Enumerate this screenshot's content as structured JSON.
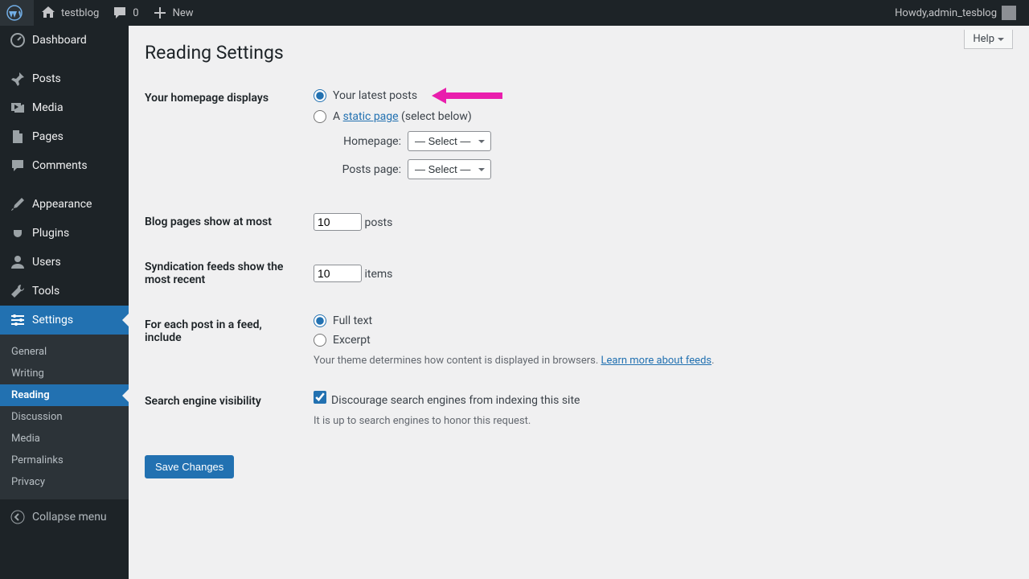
{
  "adminbar": {
    "site_name": "testblog",
    "comments_count": "0",
    "new_label": "New",
    "howdy_prefix": "Howdy, ",
    "user_name": "admin_tesblog"
  },
  "sidebar": {
    "items": [
      {
        "label": "Dashboard",
        "icon": "dashboard"
      },
      {
        "label": "Posts",
        "icon": "pin"
      },
      {
        "label": "Media",
        "icon": "media"
      },
      {
        "label": "Pages",
        "icon": "page"
      },
      {
        "label": "Comments",
        "icon": "comment"
      },
      {
        "label": "Appearance",
        "icon": "brush"
      },
      {
        "label": "Plugins",
        "icon": "plug"
      },
      {
        "label": "Users",
        "icon": "user"
      },
      {
        "label": "Tools",
        "icon": "wrench"
      },
      {
        "label": "Settings",
        "icon": "settings"
      }
    ],
    "submenu": [
      {
        "label": "General"
      },
      {
        "label": "Writing"
      },
      {
        "label": "Reading"
      },
      {
        "label": "Discussion"
      },
      {
        "label": "Media"
      },
      {
        "label": "Permalinks"
      },
      {
        "label": "Privacy"
      }
    ],
    "collapse_label": "Collapse menu"
  },
  "page": {
    "help_label": "Help",
    "title": "Reading Settings",
    "homepage_displays_label": "Your homepage displays",
    "latest_posts_label": "Your latest posts",
    "static_page_prefix": "A ",
    "static_page_link": "static page",
    "static_page_suffix": " (select below)",
    "homepage_select_label": "Homepage:",
    "posts_page_select_label": "Posts page:",
    "select_placeholder": "— Select —",
    "blog_pages_label": "Blog pages show at most",
    "blog_pages_value": "10",
    "blog_pages_suffix": "posts",
    "syndication_label": "Syndication feeds show the most recent",
    "syndication_value": "10",
    "syndication_suffix": "items",
    "feed_include_label": "For each post in a feed, include",
    "feed_fulltext_label": "Full text",
    "feed_excerpt_label": "Excerpt",
    "feed_desc_prefix": "Your theme determines how content is displayed in browsers. ",
    "feed_desc_link": "Learn more about feeds",
    "feed_desc_suffix": ".",
    "visibility_label": "Search engine visibility",
    "visibility_checkbox_label": "Discourage search engines from indexing this site",
    "visibility_desc": "It is up to search engines to honor this request.",
    "save_label": "Save Changes"
  }
}
